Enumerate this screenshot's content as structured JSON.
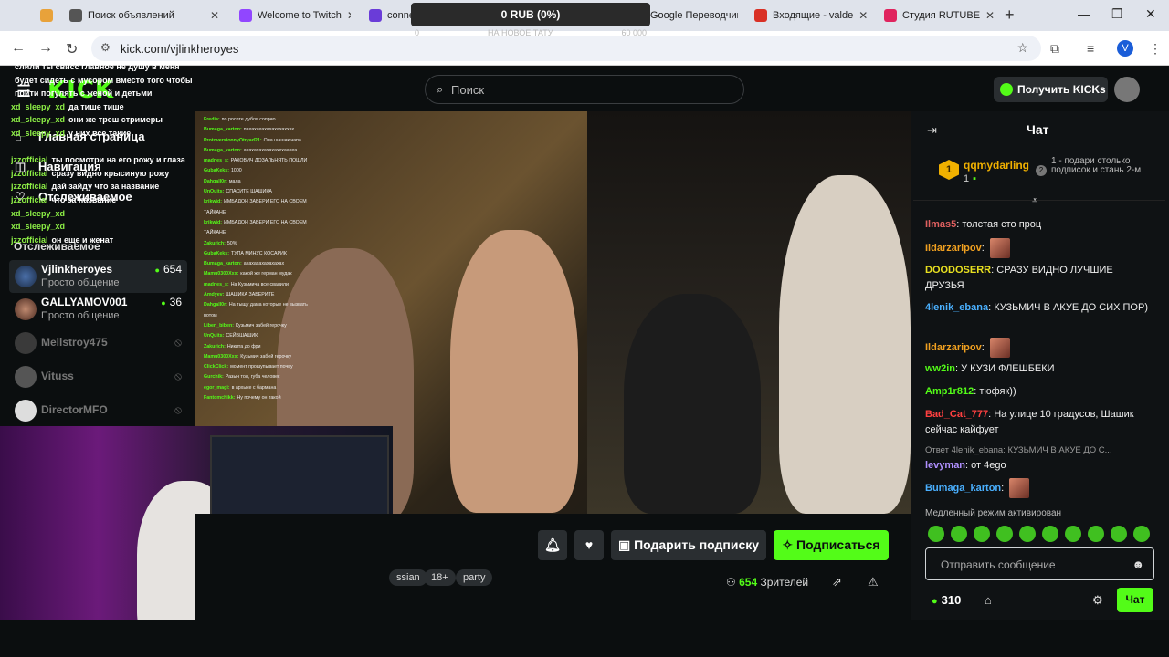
{
  "browser": {
    "tabs": [
      {
        "label": "",
        "color": "#e8a23a"
      },
      {
        "label": "Поиск объявлений",
        "color": "#555"
      },
      {
        "label": "Welcome to Twitch",
        "color": "#9146ff"
      },
      {
        "label": "conne",
        "color": "#6a3cd8"
      },
      {
        "label": "Google Переводчик",
        "color": "#3b7ef0"
      },
      {
        "label": "Входящие - valde",
        "color": "#d93025"
      },
      {
        "label": "Студия RUTUBE",
        "color": "#e0245e"
      }
    ],
    "url": "kick.com/vjlinkheroyes",
    "profile_letter": "V"
  },
  "donation": {
    "amount": "0 RUB (0%)",
    "goal_left": "0",
    "goal_text": "НА НОВОЕ ТАТУ",
    "goal_right": "60 000"
  },
  "header": {
    "logo": "KICK",
    "search_placeholder": "Поиск",
    "get_kicks": "Получить KICKs"
  },
  "sidebar": {
    "nav": [
      {
        "label": "Главная страница",
        "icon": "home-icon"
      },
      {
        "label": "Навигация",
        "icon": "compass-icon"
      },
      {
        "label": "Отслеживаемое",
        "icon": "heart-icon"
      }
    ],
    "section_title": "Отслеживаемое",
    "channels": [
      {
        "name": "Vjlinkheroyes",
        "category": "Просто общение",
        "viewers": "654",
        "live": true
      },
      {
        "name": "GALLYAMOV001",
        "category": "Просто общение",
        "viewers": "36",
        "live": true
      },
      {
        "name": "Mellstroy475",
        "category": "",
        "viewers": "",
        "live": false
      },
      {
        "name": "Vituss",
        "category": "",
        "viewers": "",
        "live": false
      },
      {
        "name": "DirectorMFO",
        "category": "",
        "viewers": "",
        "live": false
      }
    ]
  },
  "overlay_chat": [
    {
      "user": "",
      "text": "слили ты свисс главное не душу в меня"
    },
    {
      "user": "",
      "text": "будет сидеть с мусором вместо того чтобы"
    },
    {
      "user": "",
      "text": "пойти погулять с женой и детьми"
    },
    {
      "user": "xd_sleepy_xd",
      "text": "да тише тише"
    },
    {
      "user": "xd_sleepy_xd",
      "text": "они же треш стримеры"
    },
    {
      "user": "xd_sleepy_xd",
      "text": "у них все такие"
    },
    {
      "user": "",
      "text": ""
    },
    {
      "user": "jzzofficial",
      "text": "ты посмотри на его рожу и глаза"
    },
    {
      "user": "jzzofficial",
      "text": "сразу видно крысиную рожу"
    },
    {
      "user": "jzzofficial",
      "text": "дай зайду что за название"
    },
    {
      "user": "jzzofficial",
      "text": "что за название"
    },
    {
      "user": "xd_sleepy_xd",
      "text": ""
    },
    {
      "user": "xd_sleepy_xd",
      "text": ""
    },
    {
      "user": "jzzofficial",
      "text": "он еще и женат"
    }
  ],
  "video_chat": [
    {
      "user": "Fredia:",
      "text": "по росоте дубля соприо"
    },
    {
      "user": "Bumaga_karton:",
      "text": "пахахахахахахахаххах"
    },
    {
      "user": "ProtoversionnyOtryad21:",
      "text": "Ола шашик чапа"
    },
    {
      "user": "Bumaga_karton:",
      "text": "ахахахахахахахххаааха"
    },
    {
      "user": "madnes_s:",
      "text": "РАКОВИЧ ДОЗАЛЬНЯТЬ ПОШЛИ"
    },
    {
      "user": "GubaKeks:",
      "text": "1000"
    },
    {
      "user": "Dahgall0r:",
      "text": "мала"
    },
    {
      "user": "UnQuits:",
      "text": "СПАСИТЕ ШАШИКА"
    },
    {
      "user": "krikwid:",
      "text": "ИМБАДОН ЗАБЕРИ ЕГО НА СВОЕМ ТАЙКАНЕ"
    },
    {
      "user": "krikwid:",
      "text": "ИМБАДОН ЗАБЕРИ ЕГО НА СВОЕМ ТАЙКАНЕ"
    },
    {
      "user": "Zakurich:",
      "text": "50%"
    },
    {
      "user": "GubaKeks:",
      "text": "ТУПА МИНУС КОСАРИК"
    },
    {
      "user": "Bumaga_karton:",
      "text": "ахахахахахахахах"
    },
    {
      "user": "Mamu0300Xxx:",
      "text": "какой же герман мудак"
    },
    {
      "user": "madnes_s:",
      "text": "На Кузьмича все свалили"
    },
    {
      "user": "Amdyev:",
      "text": "ШАШИКА ЗАБЕРИТЕ"
    },
    {
      "user": "Dahgall0r:",
      "text": "На тыщу дама которые не вызвать потом"
    },
    {
      "user": "Liben_biben:",
      "text": "Кузьмич забей герочку"
    },
    {
      "user": "UnQuits:",
      "text": "СЕЙВШАШИК"
    },
    {
      "user": "Zakurich:",
      "text": "Никита до фри"
    },
    {
      "user": "Mamu0300Xxx:",
      "text": "Кузьмич забей герочку"
    },
    {
      "user": "ClickClick:",
      "text": "момент прошупывает почву"
    },
    {
      "user": "Gurchik:",
      "text": "Разыч тол, губа человек"
    },
    {
      "user": "egor_magi:",
      "text": "в архыке с бармана"
    },
    {
      "user": "Fantomchikk:",
      "text": "Ну почему он такой"
    }
  ],
  "stream": {
    "gift_sub": "Подарить подписку",
    "subscribe": "Подписаться",
    "tags": [
      "ssian",
      "18+",
      "party"
    ],
    "viewers_count": "654",
    "viewers_label": "Зрителей"
  },
  "chat": {
    "title": "Чат",
    "leader": {
      "rank": "1",
      "name": "qqmydarling",
      "count": "1"
    },
    "leader_note_rank": "2",
    "leader_note": "1 - подари столько подписок и стань 2-м",
    "messages": [
      {
        "user": "Ilmas5",
        "color": "#e06060",
        "text": "толстая сто проц",
        "emote": false
      },
      {
        "user": "Ildarzaripov",
        "color": "#f0a020",
        "text": "",
        "emote": true
      },
      {
        "user": "DOODOSERR",
        "color": "#e8e020",
        "text": "СРАЗУ ВИДНО ЛУЧШИЕ ДРУЗЬЯ",
        "emote": false
      },
      {
        "user": "4lenik_ebana",
        "color": "#4ab0ff",
        "text": "КУЗЬМИЧ В АКУЕ ДО СИХ ПОР)",
        "emote": false
      },
      {
        "user": "Ildarzaripov",
        "color": "#f0a020",
        "text": "",
        "emote": true
      },
      {
        "user": "ww2in",
        "color": "#53fc18",
        "text": "У КУЗИ ФЛЕШБЕКИ",
        "emote": false
      },
      {
        "user": "Amp1r812",
        "color": "#53fc18",
        "text": "тюфяк))",
        "emote": false
      },
      {
        "user": "Bad_Cat_777",
        "color": "#ff4040",
        "text": "На улице 10 градусов, Шашик сейчас кайфует",
        "emote": false
      },
      {
        "user": "levyman",
        "color": "#b090ff",
        "text": "от 4ego",
        "emote": false
      },
      {
        "user": "Bumaga_karton",
        "color": "#4ab0ff",
        "text": "",
        "emote": true
      }
    ],
    "reply_text": "Ответ 4lenik_ebana: КУЗЬМИЧ В АКУЕ ДО С...",
    "slow_mode": "Медленный режим активирован",
    "input_placeholder": "Отправить сообщение",
    "points": "310",
    "chat_button": "Чат"
  },
  "colors": {
    "brand": "#53fc18",
    "bg": "#0b0e0f"
  }
}
